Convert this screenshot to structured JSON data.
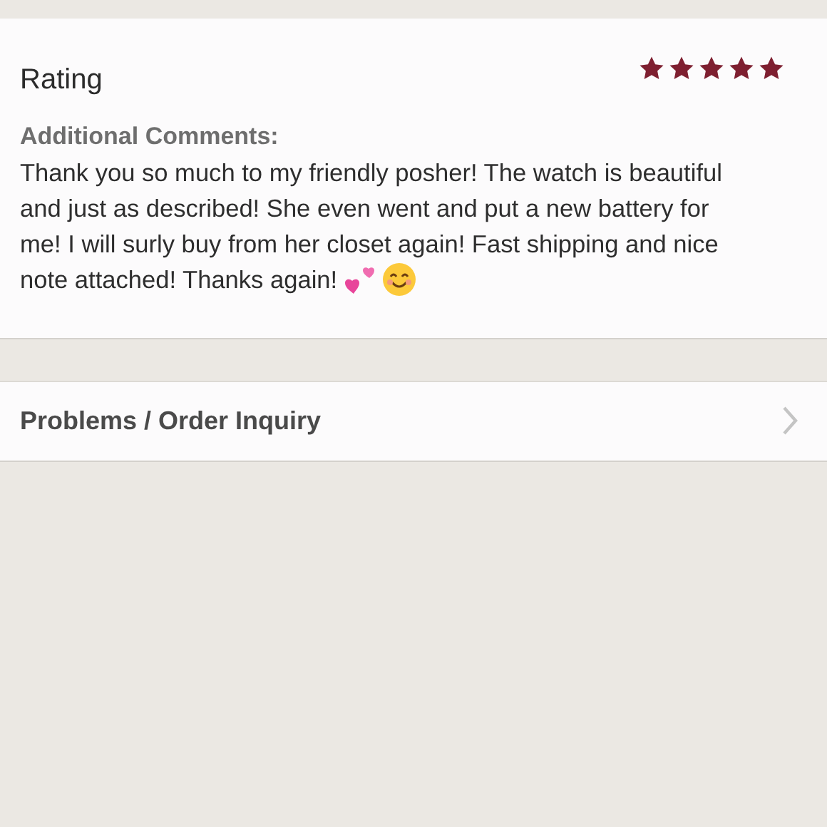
{
  "rating": {
    "label": "Rating",
    "stars": 5
  },
  "comments": {
    "label": "Additional Comments:",
    "lines": [
      "Thank you so much to my friendly posher! The watch is beautiful",
      "and just as described! She even went and put a new battery for",
      "me! I will surly buy from her closet again! Fast shipping and nice",
      "note attached! Thanks again!"
    ]
  },
  "links": [
    {
      "label": "Problems / Order Inquiry"
    }
  ]
}
